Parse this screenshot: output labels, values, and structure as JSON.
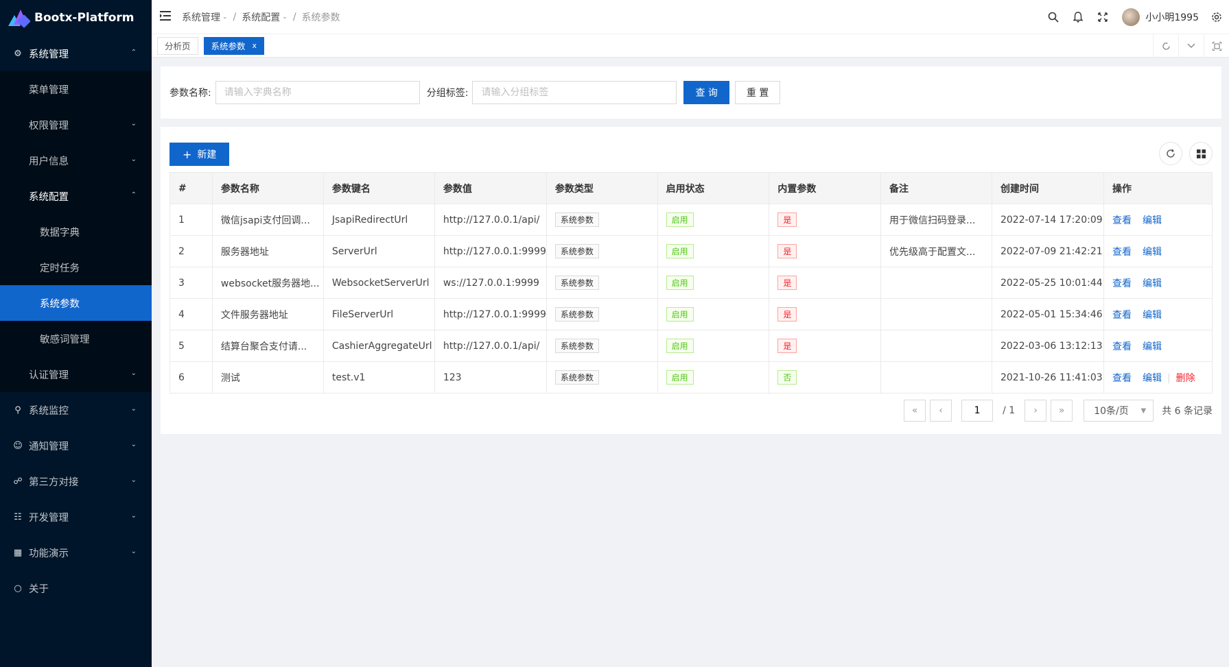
{
  "app": {
    "title": "Bootx-Platform"
  },
  "colors": {
    "primary": "#1166cc",
    "sidebar": "#001529",
    "success": "#52c41a",
    "danger": "#f5222d"
  },
  "sidebar": {
    "items": [
      {
        "label": "系统管理",
        "icon": "gear-icon",
        "level": 1,
        "chevron": "up"
      },
      {
        "label": "菜单管理",
        "level": 2
      },
      {
        "label": "权限管理",
        "level": 2,
        "chevron": "down"
      },
      {
        "label": "用户信息",
        "level": 2,
        "chevron": "down"
      },
      {
        "label": "系统配置",
        "level": 2,
        "chevron": "up"
      },
      {
        "label": "数据字典",
        "level": 3
      },
      {
        "label": "定时任务",
        "level": 3
      },
      {
        "label": "系统参数",
        "level": 3,
        "active": true
      },
      {
        "label": "敏感词管理",
        "level": 3
      },
      {
        "label": "认证管理",
        "level": 2,
        "chevron": "down"
      },
      {
        "label": "系统监控",
        "icon": "monitor-icon",
        "level": 1,
        "chevron": "down"
      },
      {
        "label": "通知管理",
        "icon": "message-icon",
        "level": 1,
        "chevron": "down"
      },
      {
        "label": "第三方对接",
        "icon": "link-icon",
        "level": 1,
        "chevron": "down"
      },
      {
        "label": "开发管理",
        "icon": "cluster-icon",
        "level": 1,
        "chevron": "down"
      },
      {
        "label": "功能演示",
        "icon": "appstore-icon",
        "level": 1,
        "chevron": "down"
      },
      {
        "label": "关于",
        "icon": "circle-icon",
        "level": 1
      }
    ]
  },
  "header": {
    "breadcrumb": [
      "系统管理",
      "系统配置",
      "系统参数"
    ],
    "username": "小小明1995"
  },
  "tabs": [
    {
      "label": "分析页",
      "active": false
    },
    {
      "label": "系统参数",
      "active": true,
      "close": "x"
    }
  ],
  "search": {
    "name_label": "参数名称:",
    "name_placeholder": "请输入字典名称",
    "tag_label": "分组标签:",
    "tag_placeholder": "请输入分组标签",
    "query_label": "查 询",
    "reset_label": "重 置"
  },
  "toolbar": {
    "new_label": "新建"
  },
  "table": {
    "columns": [
      "#",
      "参数名称",
      "参数键名",
      "参数值",
      "参数类型",
      "启用状态",
      "内置参数",
      "备注",
      "创建时间",
      "操作"
    ],
    "rows": [
      {
        "no": "1",
        "name": "微信jsapi支付回调...",
        "key": "JsapiRedirectUrl",
        "value": "http://127.0.0.1/api/",
        "type": "系统参数",
        "status": "启用",
        "builtin": "是",
        "builtin_yes": true,
        "remark": "用于微信扫码登录...",
        "created": "2022-07-14 17:20:09",
        "deletable": false
      },
      {
        "no": "2",
        "name": "服务器地址",
        "key": "ServerUrl",
        "value": "http://127.0.0.1:9999",
        "type": "系统参数",
        "status": "启用",
        "builtin": "是",
        "builtin_yes": true,
        "remark": "优先级高于配置文...",
        "created": "2022-07-09 21:42:21",
        "deletable": false
      },
      {
        "no": "3",
        "name": "websocket服务器地...",
        "key": "WebsocketServerUrl",
        "value": "ws://127.0.0.1:9999",
        "type": "系统参数",
        "status": "启用",
        "builtin": "是",
        "builtin_yes": true,
        "remark": "",
        "created": "2022-05-25 10:01:44",
        "deletable": false
      },
      {
        "no": "4",
        "name": "文件服务器地址",
        "key": "FileServerUrl",
        "value": "http://127.0.0.1:9999",
        "type": "系统参数",
        "status": "启用",
        "builtin": "是",
        "builtin_yes": true,
        "remark": "",
        "created": "2022-05-01 15:34:46",
        "deletable": false
      },
      {
        "no": "5",
        "name": "结算台聚合支付请...",
        "key": "CashierAggregateUrl",
        "value": "http://127.0.0.1/api/",
        "type": "系统参数",
        "status": "启用",
        "builtin": "是",
        "builtin_yes": true,
        "remark": "",
        "created": "2022-03-06 13:12:13",
        "deletable": false
      },
      {
        "no": "6",
        "name": "测试",
        "key": "test.v1",
        "value": "123",
        "type": "系统参数",
        "status": "启用",
        "builtin": "否",
        "builtin_yes": false,
        "remark": "",
        "created": "2021-10-26 11:41:03",
        "deletable": true
      }
    ],
    "actions": {
      "view": "查看",
      "edit": "编辑",
      "delete": "删除"
    }
  },
  "pagination": {
    "current": "1",
    "total_pages": "/ 1",
    "page_size": "10条/页",
    "total_text": "共 6 条记录"
  }
}
